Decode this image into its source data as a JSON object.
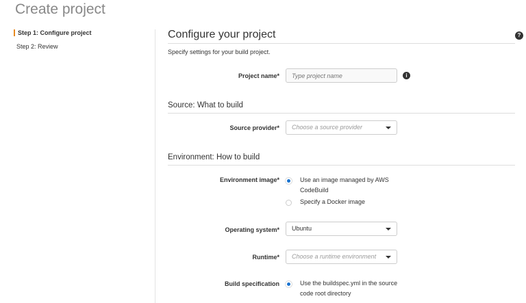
{
  "page_title": "Create project",
  "steps": [
    "Step 1: Configure project",
    "Step 2: Review"
  ],
  "section_title": "Configure your project",
  "section_subtitle": "Specify settings for your build project.",
  "project_name": {
    "label": "Project name*",
    "placeholder": "Type project name"
  },
  "source": {
    "heading": "Source: What to build",
    "provider_label": "Source provider*",
    "provider_placeholder": "Choose a source provider"
  },
  "environment": {
    "heading": "Environment: How to build",
    "image_label": "Environment image*",
    "image_options": [
      "Use an image managed by AWS CodeBuild",
      "Specify a Docker image"
    ],
    "selected_image": 0,
    "os_label": "Operating system*",
    "os_value": "Ubuntu",
    "runtime_label": "Runtime*",
    "runtime_placeholder": "Choose a runtime environment"
  },
  "buildspec": {
    "label": "Build specification",
    "option": "Use the buildspec.yml in the source code root directory"
  },
  "icons": {
    "help": "?",
    "info": "i"
  }
}
